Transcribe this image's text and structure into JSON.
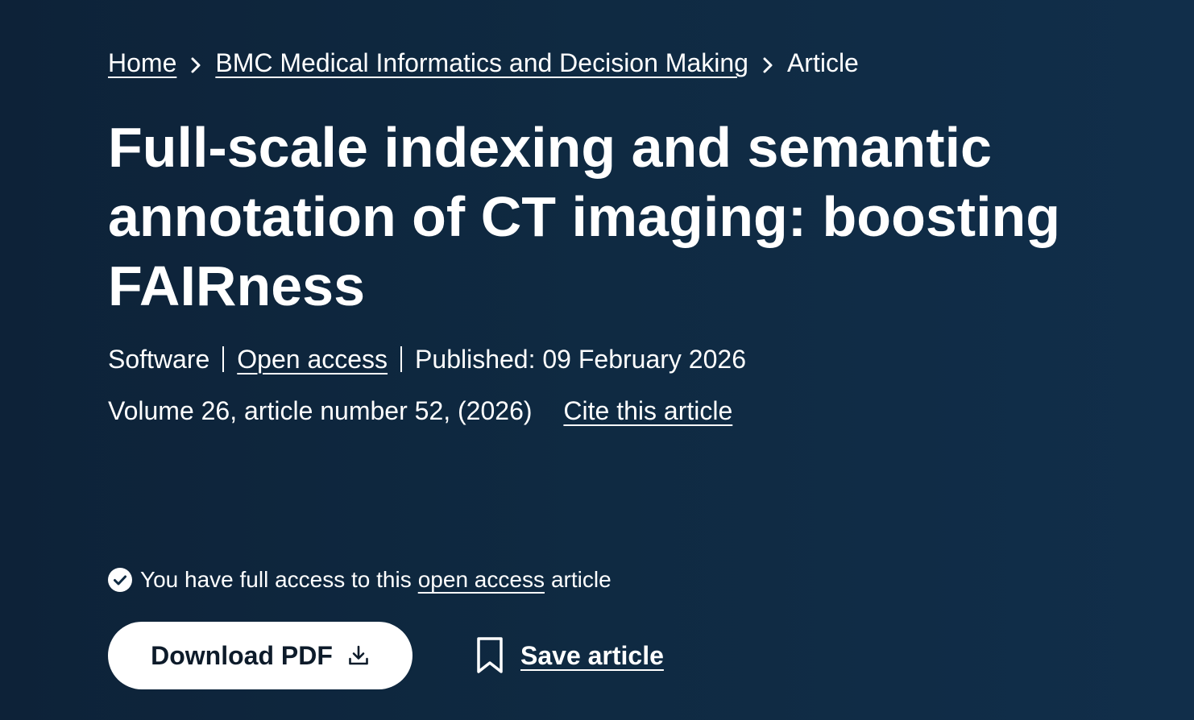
{
  "breadcrumb": {
    "home": "Home",
    "journal": "BMC Medical Informatics and Decision Making",
    "current": "Article",
    "separator_icon": "chevron-right-icon"
  },
  "article": {
    "title": "Full-scale indexing and semantic annotation of CT imaging: boosting FAIRness",
    "type": "Software",
    "open_access": "Open access",
    "published": "Published: 09 February 2026",
    "volume_info": "Volume 26, article number 52, (2026)",
    "cite": "Cite this article"
  },
  "access": {
    "icon": "check-circle-icon",
    "prefix": "You have full access to this",
    "link": "open access",
    "suffix": "article"
  },
  "actions": {
    "download_label": "Download PDF",
    "download_icon": "download-icon",
    "save_label": "Save article",
    "save_icon": "bookmark-icon"
  },
  "colors": {
    "background": "#0f2a42",
    "text": "#ffffff",
    "button_bg": "#ffffff",
    "button_text": "#0d1b2a"
  }
}
